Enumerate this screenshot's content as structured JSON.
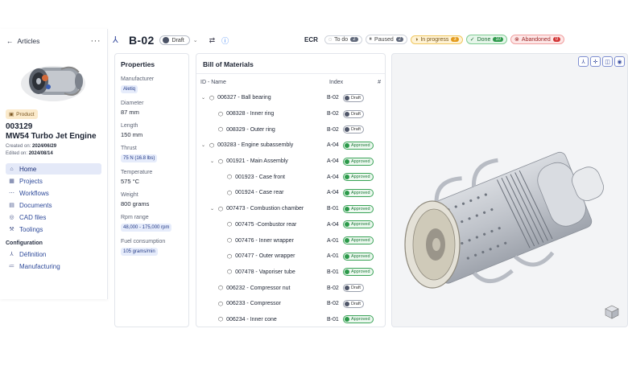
{
  "sidebar": {
    "back_label": "Articles",
    "more": "···",
    "badge": "Product",
    "part_number": "003129",
    "part_name": "MW54 Turbo Jet Engine",
    "created_label": "Created on:",
    "created_value": "2024/06/29",
    "edited_label": "Edited on:",
    "edited_value": "2024/08/14",
    "nav": [
      {
        "label": "Home",
        "icon": "home-icon",
        "active": true
      },
      {
        "label": "Projects",
        "icon": "projects-icon"
      },
      {
        "label": "Workflows",
        "icon": "workflow-icon"
      },
      {
        "label": "Documents",
        "icon": "document-icon"
      },
      {
        "label": "CAD files",
        "icon": "cad-icon"
      },
      {
        "label": "Toolings",
        "icon": "tool-icon"
      }
    ],
    "config_title": "Configuration",
    "config": [
      {
        "label": "Définition",
        "icon": "tree-icon"
      },
      {
        "label": "Manufacturing",
        "icon": "list-icon"
      }
    ]
  },
  "header": {
    "title": "B-02",
    "status": "Draft"
  },
  "ecr": {
    "label": "ECR",
    "statuses": [
      {
        "label": "To do",
        "count": "2"
      },
      {
        "label": "Paused",
        "count": "2"
      },
      {
        "label": "In progress",
        "count": "3"
      },
      {
        "label": "Done",
        "count": "10"
      },
      {
        "label": "Abandoned",
        "count": "0"
      }
    ]
  },
  "properties": {
    "title": "Properties",
    "items": [
      {
        "key": "Manufacturer",
        "value": "Aletiq",
        "chip": true
      },
      {
        "key": "Diameter",
        "value": "87 mm"
      },
      {
        "key": "Length",
        "value": "150 mm"
      },
      {
        "key": "Thrust",
        "value": "75 N (16.8 lbs)",
        "chip": true
      },
      {
        "key": "Temperature",
        "value": "575 °C"
      },
      {
        "key": "Weight",
        "value": "800 grams"
      },
      {
        "key": "Rpm range",
        "value": "48,000 - 175,000 rpm",
        "chip": true
      },
      {
        "key": "Fuel consumption",
        "value": "105 grams/min",
        "chip": true
      }
    ]
  },
  "bom": {
    "title": "Bill of Materials",
    "col_id": "ID - Name",
    "col_index": "Index",
    "col_hash": "#",
    "rows": [
      {
        "name": "006327 - Ball bearing",
        "index": "B-02",
        "status": "Draft",
        "level": 0,
        "expand": true
      },
      {
        "name": "008328 - Inner ring",
        "index": "B-02",
        "status": "Draft",
        "level": 1
      },
      {
        "name": "008329 - Outer ring",
        "index": "B-02",
        "status": "Draft",
        "level": 1
      },
      {
        "name": "003283 - Engine subassembly",
        "index": "A-04",
        "status": "Approved",
        "level": 0,
        "expand": true
      },
      {
        "name": "001921 - Main Assembly",
        "index": "A-04",
        "status": "Approved",
        "level": 1,
        "expand": true
      },
      {
        "name": "001923 - Case front",
        "index": "A-04",
        "status": "Approved",
        "level": 2
      },
      {
        "name": "001924 - Case rear",
        "index": "A-04",
        "status": "Approved",
        "level": 2
      },
      {
        "name": "007473 - Combustion chamber",
        "index": "B-01",
        "status": "Approved",
        "level": 1,
        "expand": true
      },
      {
        "name": "007475 -Combustor rear",
        "index": "A-04",
        "status": "Approved",
        "level": 2
      },
      {
        "name": "007476 - Inner wrapper",
        "index": "A-01",
        "status": "Approved",
        "level": 2
      },
      {
        "name": "007477 - Outer wrapper",
        "index": "A-01",
        "status": "Approved",
        "level": 2
      },
      {
        "name": "007478 - Vaporiser tube",
        "index": "B-01",
        "status": "Approved",
        "level": 2
      },
      {
        "name": "006232 - Compressor nut",
        "index": "B-02",
        "status": "Draft",
        "level": 1
      },
      {
        "name": "006233 - Compressor",
        "index": "B-02",
        "status": "Draft",
        "level": 1
      },
      {
        "name": "006234 - Inner cone",
        "index": "B-01",
        "status": "Approved",
        "level": 1
      }
    ]
  }
}
